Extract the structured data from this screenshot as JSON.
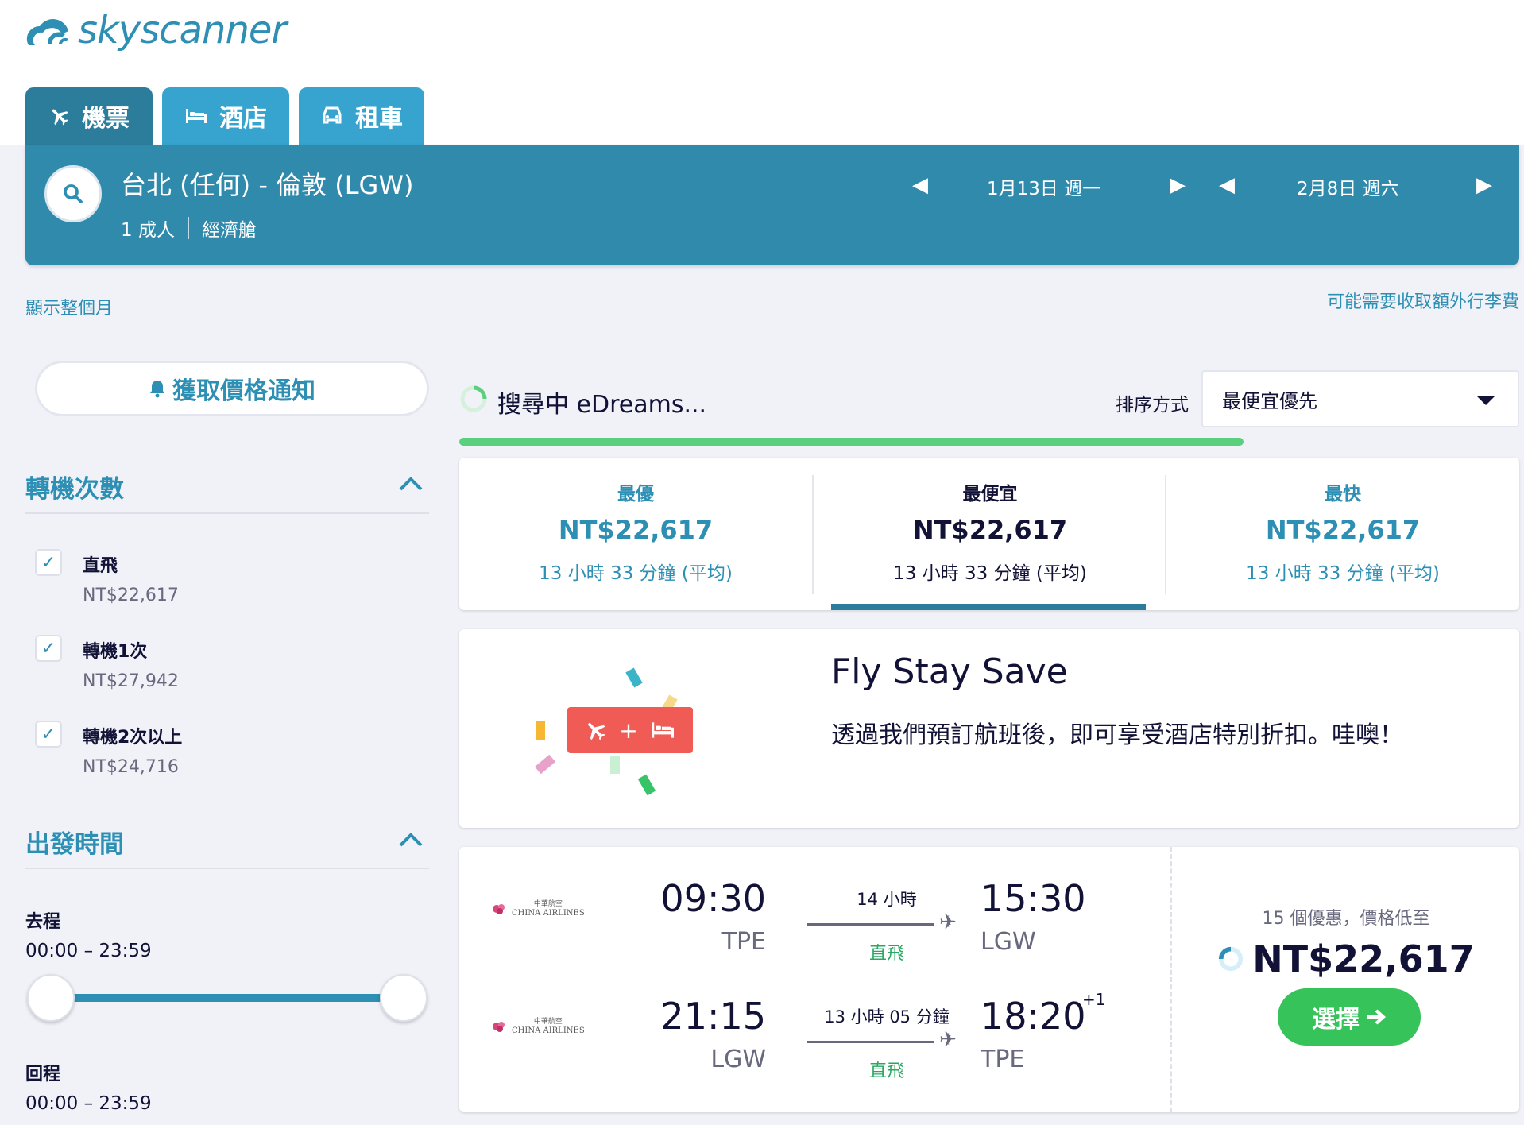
{
  "brand": {
    "name": "skyscanner",
    "color": "#2d8fb4"
  },
  "tabs": [
    {
      "label": "機票",
      "icon": "plane-icon",
      "active": true
    },
    {
      "label": "酒店",
      "icon": "bed-icon",
      "active": false
    },
    {
      "label": "租車",
      "icon": "car-icon",
      "active": false
    }
  ],
  "search": {
    "route": "台北 (任何) - 倫敦 (LGW)",
    "passengers": "1 成人",
    "cabin": "經濟艙",
    "depart_date": "1月13日 週一",
    "return_date": "2月8日 週六"
  },
  "links": {
    "show_month": "顯示整個月",
    "baggage_fee": "可能需要收取額外行李費"
  },
  "sidebar": {
    "price_alert": "獲取價格通知",
    "stops_title": "轉機次數",
    "stops": [
      {
        "label": "直飛",
        "price": "NT$22,617",
        "checked": true
      },
      {
        "label": "轉機1次",
        "price": "NT$27,942",
        "checked": true
      },
      {
        "label": "轉機2次以上",
        "price": "NT$24,716",
        "checked": true
      }
    ],
    "times_title": "出發時間",
    "outbound_label": "去程",
    "outbound_range": "00:00 – 23:59",
    "return_label": "回程",
    "return_range": "00:00 – 23:59"
  },
  "results": {
    "searching_text": "搜尋中 eDreams...",
    "sort_label": "排序方式",
    "sort_value": "最便宜優先",
    "progress": 0.74,
    "summary": [
      {
        "label": "最優",
        "price": "NT$22,617",
        "duration": "13 小時 33 分鐘 (平均)"
      },
      {
        "label": "最便宜",
        "price": "NT$22,617",
        "duration": "13 小時 33 分鐘 (平均)",
        "selected": true
      },
      {
        "label": "最快",
        "price": "NT$22,617",
        "duration": "13 小時 33 分鐘 (平均)"
      }
    ],
    "promo": {
      "title": "Fly Stay Save",
      "text": "透過我們預訂航班後，即可享受酒店特別折扣。哇噢！",
      "badge_plus": "+"
    },
    "flight": {
      "airline_chinese": "中華航空",
      "airline": "CHINA AIRLINES",
      "legs": [
        {
          "depart_time": "09:30",
          "depart_airport": "TPE",
          "duration": "14 小時",
          "stops": "直飛",
          "arrive_time": "15:30",
          "arrive_airport": "LGW",
          "day_offset": ""
        },
        {
          "depart_time": "21:15",
          "depart_airport": "LGW",
          "duration": "13 小時 05 分鐘",
          "stops": "直飛",
          "arrive_time": "18:20",
          "arrive_airport": "TPE",
          "day_offset": "+1"
        }
      ],
      "deals_text": "15 個優惠，價格低至",
      "price": "NT$22,617",
      "select_label": "選擇"
    }
  }
}
